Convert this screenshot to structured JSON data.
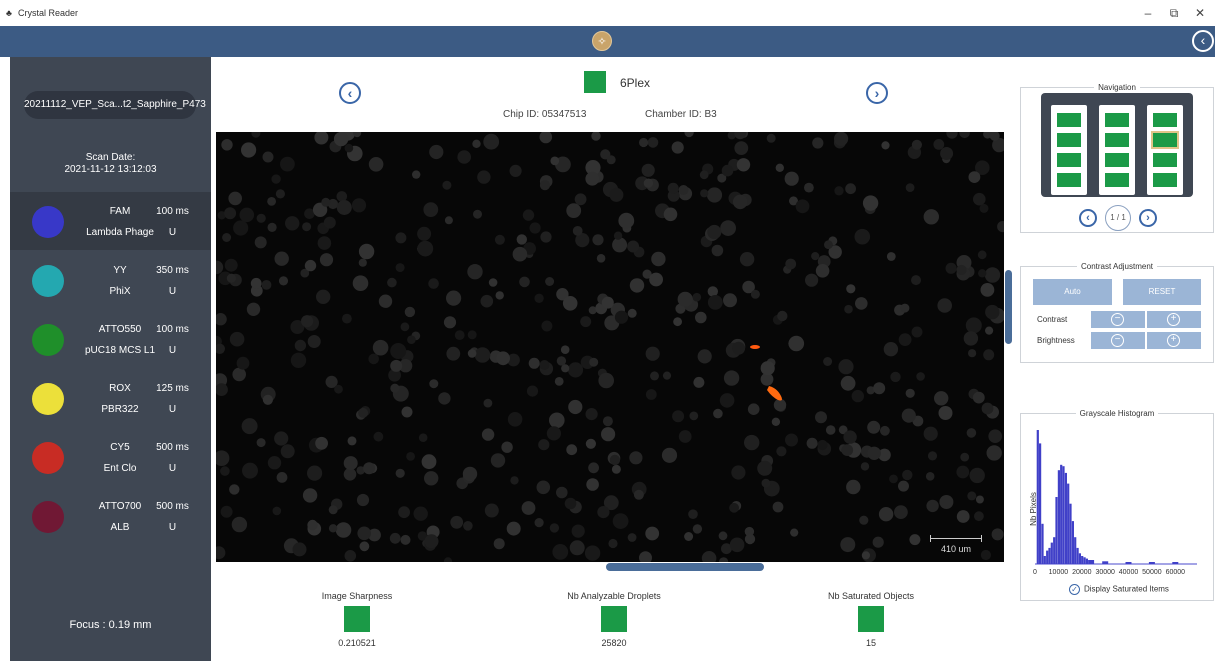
{
  "window": {
    "title": "Crystal Reader",
    "controls": {
      "minimize": "–",
      "maximize": "⧉",
      "close": "✕"
    }
  },
  "header": {
    "back_icon": "‹"
  },
  "sidebar": {
    "scan_name": "20211112_VEP_Sca...t2_Sapphire_P473",
    "scan_date_label": "Scan Date:",
    "scan_date": "2021-11-12 13:12:03",
    "channels": [
      {
        "name": "FAM",
        "exposure": "100 ms",
        "target": "Lambda Phage",
        "unit": "U",
        "color": "#3838c8",
        "active": true
      },
      {
        "name": "YY",
        "exposure": "350 ms",
        "target": "PhiX",
        "unit": "U",
        "color": "#24a8b0",
        "active": false
      },
      {
        "name": "ATTO550",
        "exposure": "100 ms",
        "target": "pUC18 MCS L1",
        "unit": "U",
        "color": "#1f8f2a",
        "active": false
      },
      {
        "name": "ROX",
        "exposure": "125 ms",
        "target": "PBR322",
        "unit": "U",
        "color": "#ece03a",
        "active": false
      },
      {
        "name": "CY5",
        "exposure": "500 ms",
        "target": "Ent Clo",
        "unit": "U",
        "color": "#c82c24",
        "active": false
      },
      {
        "name": "ATTO700",
        "exposure": "500 ms",
        "target": "ALB",
        "unit": "U",
        "color": "#701834",
        "active": false
      }
    ],
    "focus": "Focus : 0.19 mm"
  },
  "main": {
    "prev_icon": "‹",
    "next_icon": "›",
    "plex_label": "6Plex",
    "chip_id": "Chip ID: 05347513",
    "chamber_id": "Chamber ID: B3",
    "scale_label": "410 um",
    "metrics": [
      {
        "label": "Image Sharpness",
        "value": "0.210521"
      },
      {
        "label": "Nb Analyzable Droplets",
        "value": "25820"
      },
      {
        "label": "Nb Saturated Objects",
        "value": "15"
      }
    ]
  },
  "navigation": {
    "title": "Navigation",
    "page": "1 / 1",
    "selected_chamber": "B3"
  },
  "contrast": {
    "title": "Contrast Adjustment",
    "auto_label": "Auto",
    "reset_label": "RESET",
    "contrast_label": "Contrast",
    "brightness_label": "Brightness"
  },
  "histogram": {
    "title": "Grayscale Histogram",
    "ylabel": "Nb Pixels",
    "x_ticks": [
      "0",
      "10000",
      "20000",
      "30000",
      "40000",
      "50000",
      "60000"
    ],
    "saturated_label": "Display Saturated Items"
  },
  "chart_data": {
    "type": "bar",
    "title": "Grayscale Histogram",
    "xlabel": "",
    "ylabel": "Nb Pixels",
    "xlim": [
      0,
      65000
    ],
    "x": [
      1200,
      2200,
      3200,
      4200,
      5200,
      6200,
      7200,
      8200,
      9200,
      10200,
      11200,
      12200,
      13200,
      14200,
      15200,
      16200,
      17200,
      18200,
      19200,
      20200,
      21200,
      22200,
      24000,
      30000,
      40000,
      50000,
      60000
    ],
    "values": [
      1.0,
      0.9,
      0.3,
      0.06,
      0.1,
      0.12,
      0.16,
      0.2,
      0.5,
      0.7,
      0.74,
      0.73,
      0.68,
      0.6,
      0.45,
      0.32,
      0.2,
      0.12,
      0.08,
      0.06,
      0.05,
      0.04,
      0.03,
      0.02,
      0.015,
      0.015,
      0.015
    ]
  }
}
